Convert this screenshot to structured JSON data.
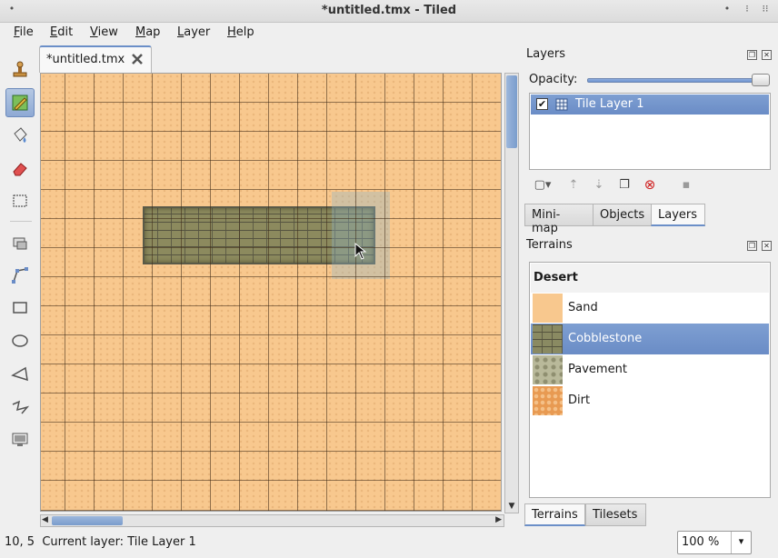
{
  "window": {
    "title": "*untitled.tmx - Tiled",
    "left_button": "•",
    "right_buttons": [
      "•",
      "⁝",
      "⁝⁝"
    ]
  },
  "menu": [
    "File",
    "Edit",
    "View",
    "Map",
    "Layer",
    "Help"
  ],
  "tools": [
    {
      "icon": "stamp-brush-icon",
      "active": false
    },
    {
      "icon": "terrain-brush-icon",
      "active": true
    },
    {
      "icon": "bucket-fill-icon",
      "active": false
    },
    {
      "icon": "eraser-icon",
      "active": false
    },
    {
      "icon": "rectangular-select-icon",
      "active": false
    },
    {
      "icon": "select-objects-icon",
      "active": false
    },
    {
      "icon": "edit-polygons-icon",
      "active": false
    },
    {
      "icon": "insert-rectangle-icon",
      "active": false
    },
    {
      "icon": "insert-ellipse-icon",
      "active": false
    },
    {
      "icon": "insert-polygon-icon",
      "active": false
    },
    {
      "icon": "insert-polyline-icon",
      "active": false
    },
    {
      "icon": "insert-tile-icon",
      "active": false
    }
  ],
  "document_tab": {
    "label": "*untitled.tmx"
  },
  "layers_panel": {
    "title": "Layers",
    "opacity_label": "Opacity:",
    "opacity": 1.0,
    "layers": [
      {
        "name": "Tile Layer 1",
        "visible": true,
        "selected": true
      }
    ]
  },
  "upper_tabs": [
    {
      "label": "Mini-map",
      "selected": false
    },
    {
      "label": "Objects",
      "selected": false
    },
    {
      "label": "Layers",
      "selected": true
    }
  ],
  "terrains_panel": {
    "title": "Terrains",
    "group": "Desert",
    "items": [
      {
        "name": "Sand",
        "selected": false,
        "swatch": "#f8c88e"
      },
      {
        "name": "Cobblestone",
        "selected": true,
        "swatch": "#8a8a62"
      },
      {
        "name": "Pavement",
        "selected": false,
        "swatch": "#b9b99a"
      },
      {
        "name": "Dirt",
        "selected": false,
        "swatch": "#e89a52"
      }
    ]
  },
  "lower_tabs": [
    {
      "label": "Terrains",
      "selected": true
    },
    {
      "label": "Tilesets",
      "selected": false
    }
  ],
  "statusbar": {
    "text": "10, 5  Current layer: Tile Layer 1",
    "zoom": "100 %"
  },
  "colors": {
    "accent": "#6b8fc8",
    "selection": "#6a8cc6",
    "sand": "#f8c88e"
  }
}
